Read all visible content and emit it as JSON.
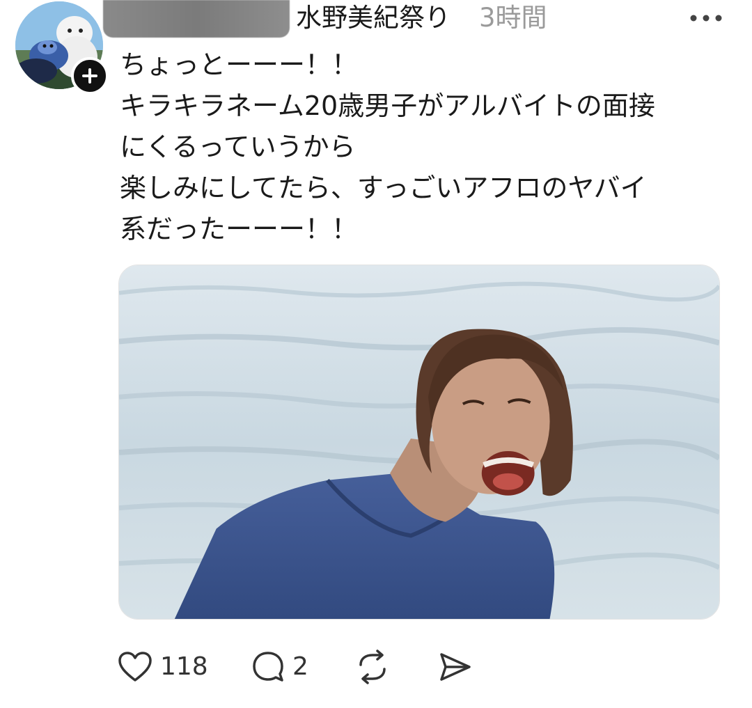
{
  "post": {
    "username": "水野美紀祭り",
    "timestamp": "3時間",
    "text_lines": [
      "ちょっとーーー！！",
      "キラキラネーム20歳男子がアルバイトの面接",
      "にくるっていうから",
      "楽しみにしてたら、すっごいアフロのヤバイ",
      "系だったーーー！！"
    ]
  },
  "actions": {
    "like_count": "118",
    "reply_count": "2"
  },
  "icons": {
    "follow": "plus-icon",
    "more": "more-horizontal-icon",
    "like": "heart-icon",
    "reply": "speech-bubble-icon",
    "repost": "repost-icon",
    "share": "send-icon"
  },
  "colors": {
    "text": "#1a1a1a",
    "muted": "#9a9a9a",
    "icon": "#333333"
  }
}
